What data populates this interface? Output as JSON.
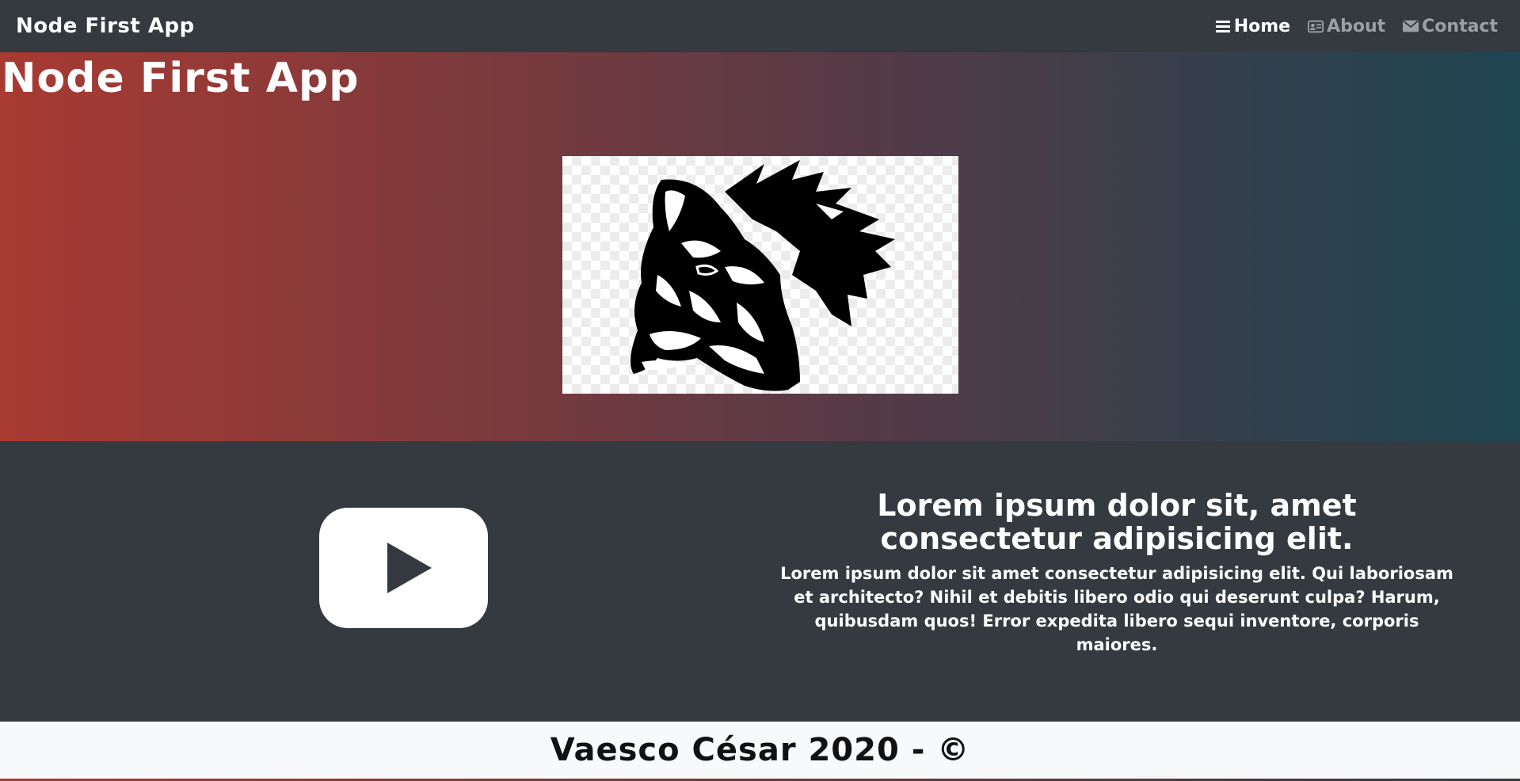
{
  "navbar": {
    "brand": "Node First App",
    "links": [
      {
        "label": "Home",
        "icon": "menu-icon",
        "active": true
      },
      {
        "label": "About",
        "icon": "id-card-icon",
        "active": false
      },
      {
        "label": "Contact",
        "icon": "envelope-icon",
        "active": false
      }
    ]
  },
  "hero": {
    "title": "Node First App",
    "image": "wolf-head-logo"
  },
  "feature": {
    "media_icon": "play-video-icon",
    "heading": "Lorem ipsum dolor sit, amet consectetur adipisicing elit.",
    "body": "Lorem ipsum dolor sit amet consectetur adipisicing elit. Qui laboriosam et architecto? Nihil et debitis libero odio qui deserunt culpa? Harum, quibusdam quos! Error expedita libero sequi inventore, corporis maiores."
  },
  "footer": {
    "text": "Vaesco César 2020 - ©"
  },
  "colors": {
    "navbar_bg": "#343a40",
    "hero_gradient_start": "#a83a32",
    "hero_gradient_end": "#1e4552",
    "footer_bg": "#f8f9fa"
  }
}
